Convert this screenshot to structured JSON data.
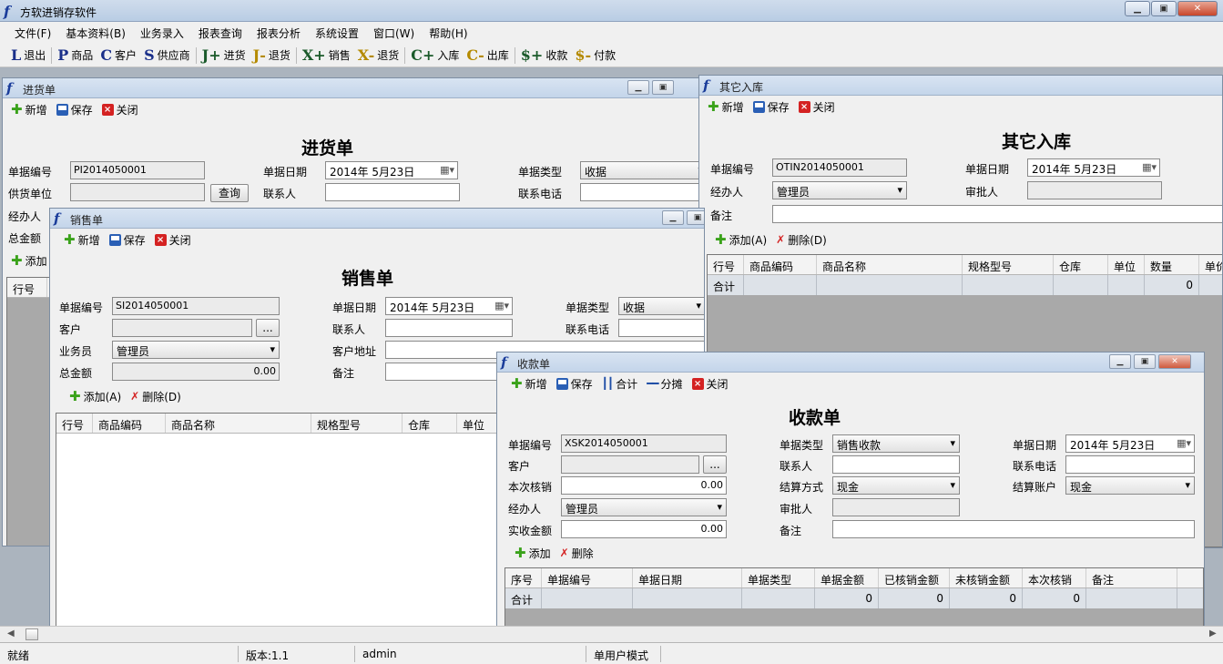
{
  "app": {
    "title": "方软进销存软件"
  },
  "menu": [
    "文件(F)",
    "基本资料(B)",
    "业务录入",
    "报表查询",
    "报表分析",
    "系统设置",
    "窗口(W)",
    "帮助(H)"
  ],
  "toolbar": [
    {
      "icon": "L",
      "label": "退出",
      "color": "#1a2f8a"
    },
    {
      "icon": "P",
      "label": "商品",
      "color": "#1a2f8a"
    },
    {
      "icon": "C",
      "label": "客户",
      "color": "#1a2f8a"
    },
    {
      "icon": "S",
      "label": "供应商",
      "color": "#1a2f8a"
    },
    {
      "icon": "J+",
      "label": "进货",
      "color": "#1a5a2a"
    },
    {
      "icon": "J-",
      "label": "退货",
      "color": "#b48a00"
    },
    {
      "icon": "X+",
      "label": "销售",
      "color": "#1a5a2a"
    },
    {
      "icon": "X-",
      "label": "退货",
      "color": "#b48a00"
    },
    {
      "icon": "C+",
      "label": "入库",
      "color": "#1a5a2a"
    },
    {
      "icon": "C-",
      "label": "出库",
      "color": "#b48a00"
    },
    {
      "icon": "$+",
      "label": "收款",
      "color": "#1a5a2a"
    },
    {
      "icon": "$-",
      "label": "付款",
      "color": "#b48a00"
    }
  ],
  "purchase": {
    "title": "进货单",
    "heading": "进货单",
    "btn_new": "新增",
    "btn_save": "保存",
    "btn_close": "关闭",
    "lbl_no": "单据编号",
    "val_no": "PI2014050001",
    "lbl_date": "单据日期",
    "val_date": "2014年 5月23日",
    "lbl_type": "单据类型",
    "val_type": "收据",
    "lbl_supplier": "供货单位",
    "btn_query": "查询",
    "lbl_contact": "联系人",
    "lbl_phone": "联系电话",
    "lbl_handler": "经办人",
    "lbl_total": "总金额",
    "btn_add": "添加",
    "col_row": "行号"
  },
  "other_in": {
    "title": "其它入库",
    "heading": "其它入库",
    "btn_new": "新增",
    "btn_save": "保存",
    "btn_close": "关闭",
    "lbl_no": "单据编号",
    "val_no": "OTIN2014050001",
    "lbl_date": "单据日期",
    "val_date": "2014年 5月23日",
    "lbl_handler": "经办人",
    "val_handler": "管理员",
    "lbl_approver": "审批人",
    "lbl_remark": "备注",
    "btn_add": "添加(A)",
    "btn_delete": "删除(D)",
    "columns": [
      "行号",
      "商品编码",
      "商品名称",
      "规格型号",
      "仓库",
      "单位",
      "数量",
      "单价"
    ],
    "total_row": [
      "合计",
      "",
      "",
      "",
      "",
      "",
      "0",
      ""
    ]
  },
  "sales": {
    "title": "销售单",
    "heading": "销售单",
    "btn_new": "新增",
    "btn_save": "保存",
    "btn_close": "关闭",
    "lbl_no": "单据编号",
    "val_no": "SI2014050001",
    "lbl_date": "单据日期",
    "val_date": "2014年 5月23日",
    "lbl_type": "单据类型",
    "val_type": "收据",
    "lbl_customer": "客户",
    "btn_browse": "...",
    "lbl_contact": "联系人",
    "lbl_phone": "联系电话",
    "lbl_salesman": "业务员",
    "val_salesman": "管理员",
    "lbl_address": "客户地址",
    "lbl_total": "总金额",
    "val_total": "0.00",
    "lbl_remark": "备注",
    "btn_add": "添加(A)",
    "btn_delete": "删除(D)",
    "columns": [
      "行号",
      "商品编码",
      "商品名称",
      "规格型号",
      "仓库",
      "单位"
    ]
  },
  "receipt": {
    "title": "收款单",
    "heading": "收款单",
    "btn_new": "新增",
    "btn_save": "保存",
    "btn_sum": "合计",
    "btn_split": "分摊",
    "btn_close": "关闭",
    "lbl_no": "单据编号",
    "val_no": "XSK2014050001",
    "lbl_type": "单据类型",
    "val_type": "销售收款",
    "lbl_date": "单据日期",
    "val_date": "2014年 5月23日",
    "lbl_customer": "客户",
    "btn_browse": "...",
    "lbl_contact": "联系人",
    "lbl_phone": "联系电话",
    "lbl_writeoff": "本次核销",
    "val_writeoff": "0.00",
    "lbl_method": "结算方式",
    "val_method": "现金",
    "lbl_account": "结算账户",
    "val_account": "现金",
    "lbl_handler": "经办人",
    "val_handler": "管理员",
    "lbl_approver": "审批人",
    "lbl_actual": "实收金额",
    "val_actual": "0.00",
    "lbl_remark": "备注",
    "btn_add": "添加",
    "btn_delete": "删除",
    "columns": [
      "序号",
      "单据编号",
      "单据日期",
      "单据类型",
      "单据金额",
      "已核销金额",
      "未核销金额",
      "本次核销",
      "备注"
    ],
    "total_row": [
      "合计",
      "",
      "",
      "",
      "0",
      "0",
      "0",
      "0",
      ""
    ]
  },
  "status": {
    "ready": "就绪",
    "version": "版本:1.1",
    "user": "admin",
    "mode": "单用户模式"
  }
}
